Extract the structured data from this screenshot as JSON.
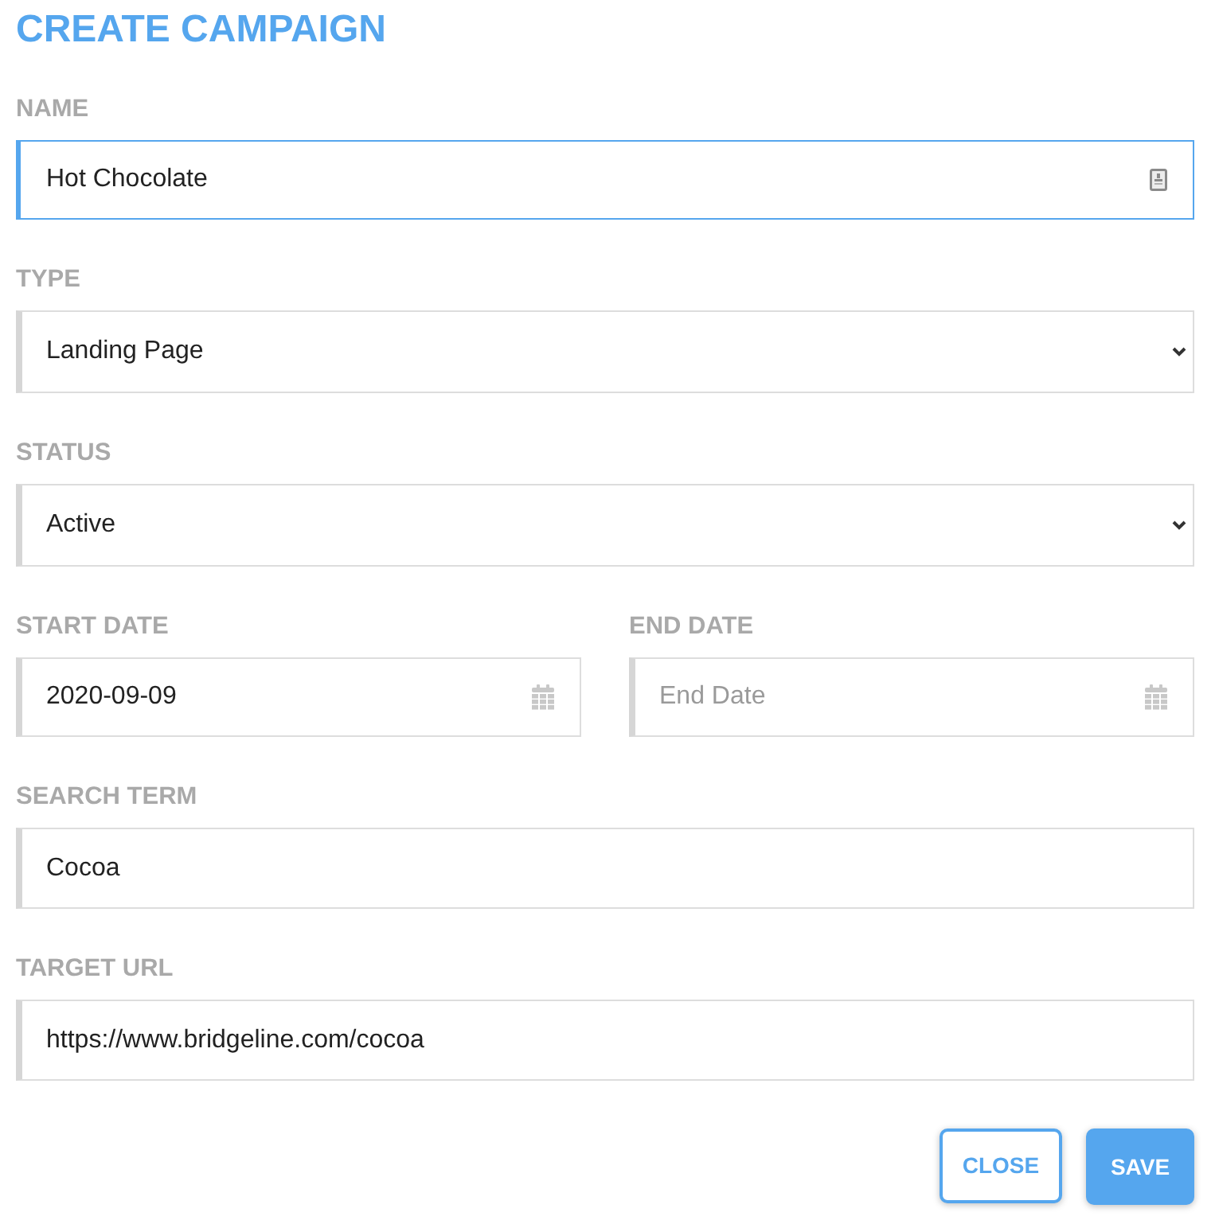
{
  "title": "CREATE CAMPAIGN",
  "rows": [
    {
      "fields": [
        {
          "kind": "autofill",
          "label": "NAME",
          "value": "Hot Chocolate",
          "focused": true
        }
      ]
    },
    {
      "fields": [
        {
          "kind": "select",
          "label": "TYPE",
          "value": "Landing Page",
          "focused": false
        }
      ]
    },
    {
      "fields": [
        {
          "kind": "select",
          "label": "STATUS",
          "value": "Active",
          "focused": false
        }
      ]
    },
    {
      "fields": [
        {
          "kind": "date",
          "label": "START DATE",
          "value": "2020-09-09",
          "focused": false
        },
        {
          "kind": "date",
          "label": "END DATE",
          "placeholder": "End Date",
          "focused": false
        }
      ]
    },
    {
      "fields": [
        {
          "kind": "text",
          "label": "SEARCH TERM",
          "value": "Cocoa",
          "focused": false
        }
      ]
    },
    {
      "fields": [
        {
          "kind": "text",
          "label": "TARGET URL",
          "value": "https://www.bridgeline.com/cocoa",
          "focused": false
        }
      ]
    }
  ],
  "buttons": [
    {
      "kind": "outline",
      "label": "CLOSE"
    },
    {
      "kind": "filled",
      "label": "SAVE"
    }
  ]
}
